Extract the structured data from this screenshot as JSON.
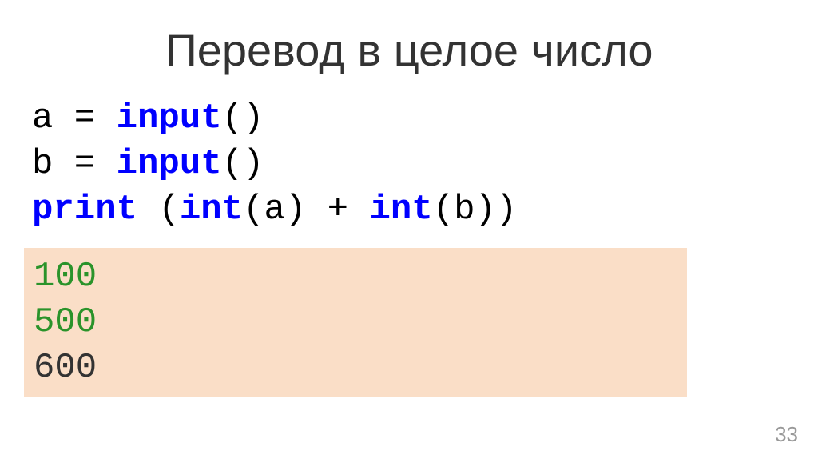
{
  "title": "Перевод в целое число",
  "code": {
    "line1": {
      "part1": "a = ",
      "keyword": "input",
      "part2": "()"
    },
    "line2": {
      "part1": "b = ",
      "keyword": "input",
      "part2": "()"
    },
    "line3": {
      "kw1": "print",
      "part1": " (",
      "kw2": "int",
      "part2": "(a) + ",
      "kw3": "int",
      "part3": "(b))"
    }
  },
  "output": {
    "line1": "100",
    "line2": "500",
    "line3": "600"
  },
  "page_number": "33"
}
